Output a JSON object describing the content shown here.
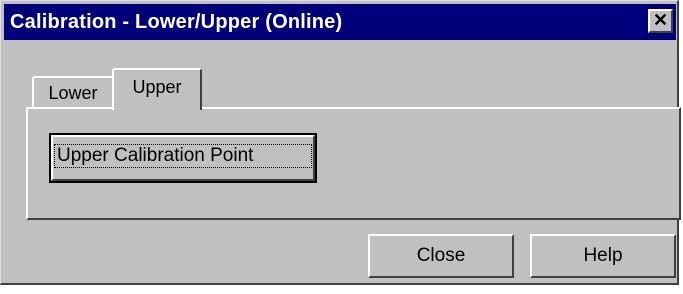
{
  "window": {
    "title": "Calibration - Lower/Upper  (Online)",
    "close_glyph": "✕"
  },
  "tabs": [
    {
      "label": "Lower",
      "active": false
    },
    {
      "label": "Upper",
      "active": true
    }
  ],
  "panel": {
    "calibration_button_label": "Upper Calibration Point"
  },
  "buttons": {
    "close_label": "Close",
    "help_label": "Help"
  },
  "colors": {
    "titlebar": "#00007b",
    "face": "#c0c0c0"
  }
}
